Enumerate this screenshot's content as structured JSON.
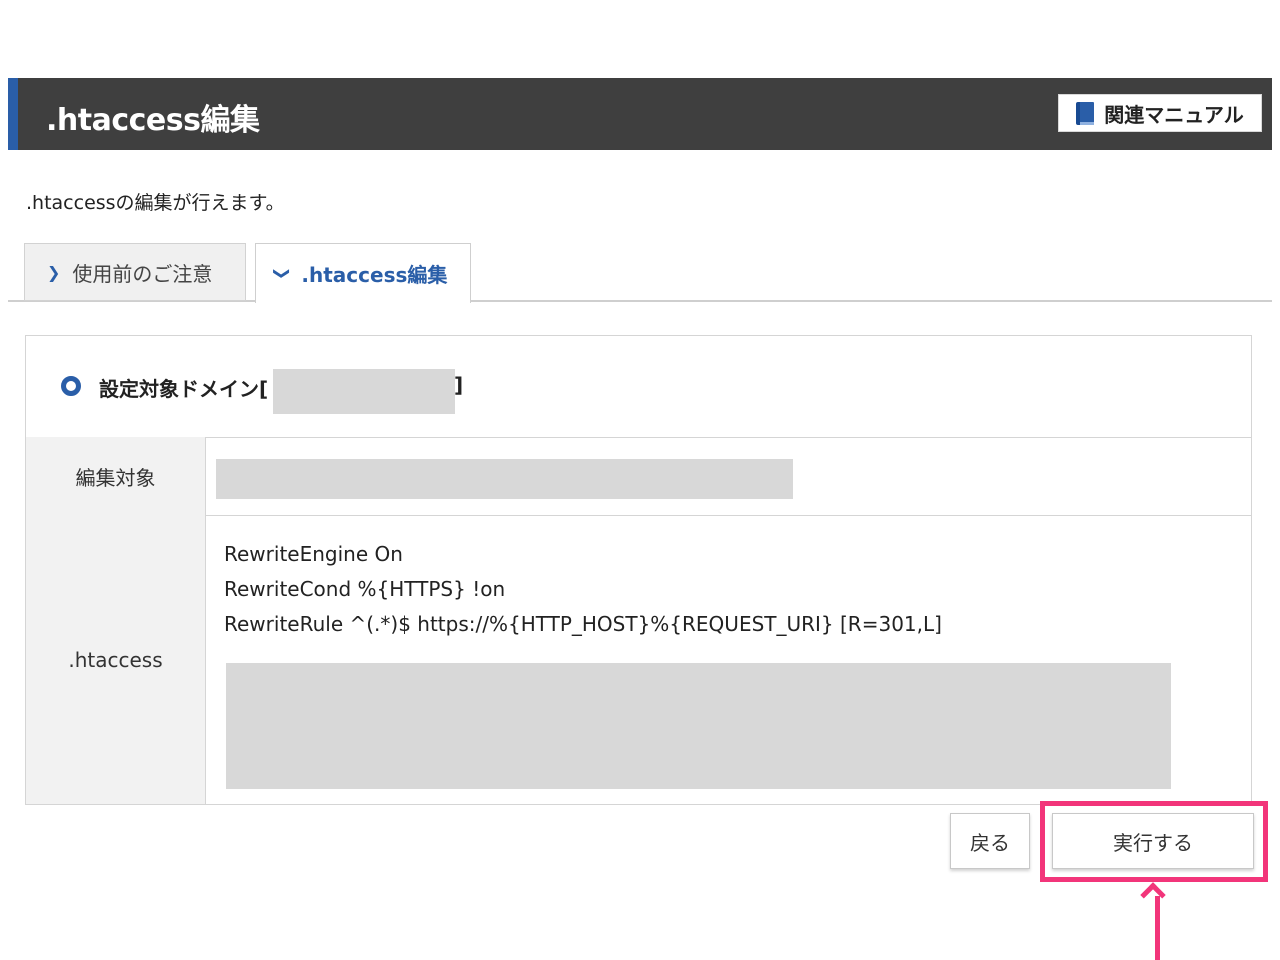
{
  "header": {
    "title": ".htaccess編集",
    "manual_button": "関連マニュアル"
  },
  "intro": ".htaccessの編集が行えます。",
  "tabs": [
    {
      "label": "使用前のご注意",
      "active": false
    },
    {
      "label": ".htaccess編集",
      "active": true
    }
  ],
  "domain": {
    "label": "設定対象ドメイン[",
    "close": "]"
  },
  "rows": {
    "target_label": "編集対象",
    "htaccess_label": ".htaccess"
  },
  "code": {
    "line1": "RewriteEngine On",
    "line2": "RewriteCond %{HTTPS} !on",
    "line3": "RewriteRule ^(.*)$ https://%{HTTP_HOST}%{REQUEST_URI} [R=301,L]"
  },
  "buttons": {
    "back": "戻る",
    "run": "実行する"
  },
  "colors": {
    "accent": "#2a5ea8",
    "header_bg": "#3f3f3f",
    "highlight": "#f2357a"
  }
}
